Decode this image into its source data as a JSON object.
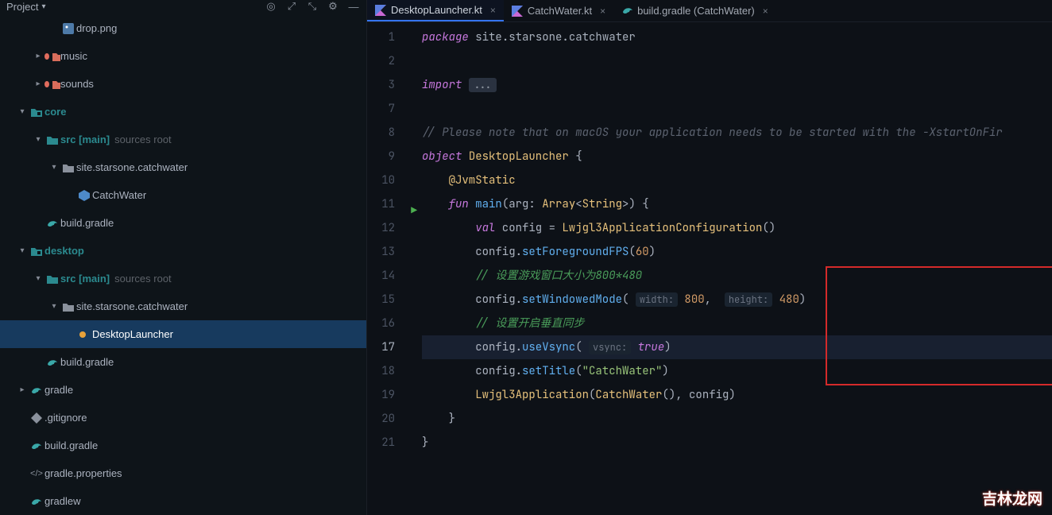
{
  "header": {
    "title": "Project"
  },
  "tree": [
    {
      "d": 3,
      "exp": "",
      "icon": "img",
      "label": "drop.png",
      "color": "#7aa2c9"
    },
    {
      "d": 2,
      "exp": "r",
      "icon": "folder-orange",
      "label": "music"
    },
    {
      "d": 2,
      "exp": "r",
      "icon": "folder-orange",
      "label": "sounds"
    },
    {
      "d": 1,
      "exp": "d",
      "icon": "module",
      "label": "core",
      "cls": "fold-teal"
    },
    {
      "d": 2,
      "exp": "d",
      "icon": "src",
      "label": "src [main]",
      "aux": "sources root",
      "cls": "fold-teal"
    },
    {
      "d": 3,
      "exp": "d",
      "icon": "pkg",
      "label": "site.starsone.catchwater"
    },
    {
      "d": 4,
      "exp": "",
      "icon": "class",
      "label": "CatchWater"
    },
    {
      "d": 2,
      "exp": "",
      "icon": "gradle",
      "label": "build.gradle"
    },
    {
      "d": 1,
      "exp": "d",
      "icon": "module",
      "label": "desktop",
      "cls": "fold-teal"
    },
    {
      "d": 2,
      "exp": "d",
      "icon": "src",
      "label": "src [main]",
      "aux": "sources root",
      "cls": "fold-teal"
    },
    {
      "d": 3,
      "exp": "d",
      "icon": "pkg",
      "label": "site.starsone.catchwater"
    },
    {
      "d": 4,
      "exp": "",
      "icon": "class-sel",
      "label": "DesktopLauncher",
      "sel": true
    },
    {
      "d": 2,
      "exp": "",
      "icon": "gradle",
      "label": "build.gradle"
    },
    {
      "d": 1,
      "exp": "r",
      "icon": "gradle-d",
      "label": "gradle"
    },
    {
      "d": 1,
      "exp": "",
      "icon": "git",
      "label": ".gitignore"
    },
    {
      "d": 1,
      "exp": "",
      "icon": "gradle",
      "label": "build.gradle"
    },
    {
      "d": 1,
      "exp": "",
      "icon": "props",
      "label": "gradle.properties"
    },
    {
      "d": 1,
      "exp": "",
      "icon": "gradle",
      "label": "gradlew"
    }
  ],
  "tabs": [
    {
      "icon": "kt",
      "label": "DesktopLauncher.kt",
      "active": true
    },
    {
      "icon": "kt",
      "label": "CatchWater.kt"
    },
    {
      "icon": "gradle",
      "label": "build.gradle (CatchWater)"
    }
  ],
  "code": {
    "lines": [
      1,
      2,
      3,
      7,
      8,
      9,
      10,
      11,
      12,
      13,
      14,
      15,
      16,
      17,
      18,
      19,
      20,
      21
    ],
    "current": 17,
    "package": "site.starsone.catchwater",
    "import_fold": "...",
    "comment1": "// Please note that on macOS your application needs to be started with the -XstartOnFir",
    "obj_name": "DesktopLauncher",
    "ann": "@JvmStatic",
    "fun_name": "main",
    "arg_name": "arg",
    "arg_type_outer": "Array",
    "arg_type_inner": "String",
    "cfg_var": "config",
    "cfg_cls": "Lwjgl3ApplicationConfiguration",
    "fps_fn": "setForegroundFPS",
    "fps_val": "60",
    "c_window": "// 设置游戏窗口大小为800*480",
    "win_fn": "setWindowedMode",
    "p_width": "width:",
    "v_width": "800",
    "p_height": "height:",
    "v_height": "480",
    "c_vsync": "// 设置开启垂直同步",
    "vsync_fn": "useVsync",
    "p_vsync": "vsync:",
    "v_vsync": "true",
    "title_fn": "setTitle",
    "title_val": "\"CatchWater\"",
    "app_cls": "Lwjgl3Application",
    "app_arg": "CatchWater"
  },
  "watermark": "吉林龙网"
}
